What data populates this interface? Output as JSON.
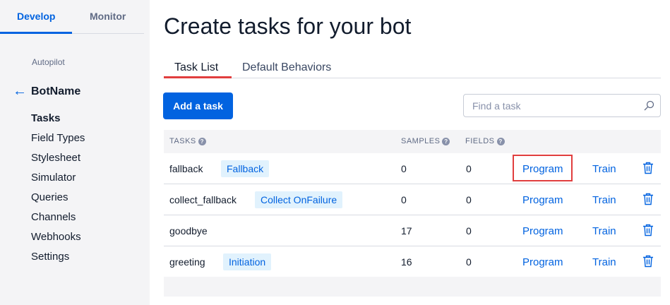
{
  "topnav": {
    "develop": "Develop",
    "monitor": "Monitor"
  },
  "sidebar": {
    "section": "Autopilot",
    "bot_name": "BotName",
    "items": [
      {
        "label": "Tasks"
      },
      {
        "label": "Field Types"
      },
      {
        "label": "Stylesheet"
      },
      {
        "label": "Simulator"
      },
      {
        "label": "Queries"
      },
      {
        "label": "Channels"
      },
      {
        "label": "Webhooks"
      },
      {
        "label": "Settings"
      }
    ]
  },
  "main": {
    "title": "Create tasks for your bot",
    "tabs": [
      {
        "label": "Task List"
      },
      {
        "label": "Default Behaviors"
      }
    ],
    "add_button": "Add a task",
    "search_placeholder": "Find a task"
  },
  "table": {
    "headers": {
      "tasks": "TASKS",
      "samples": "SAMPLES",
      "fields": "FIELDS"
    },
    "rows": [
      {
        "name": "fallback",
        "badge": "Fallback",
        "samples": "0",
        "fields": "0",
        "program": "Program",
        "train": "Train"
      },
      {
        "name": "collect_fallback",
        "badge": "Collect OnFailure",
        "samples": "0",
        "fields": "0",
        "program": "Program",
        "train": "Train"
      },
      {
        "name": "goodbye",
        "badge": "",
        "samples": "17",
        "fields": "0",
        "program": "Program",
        "train": "Train"
      },
      {
        "name": "greeting",
        "badge": "Initiation",
        "samples": "16",
        "fields": "0",
        "program": "Program",
        "train": "Train"
      }
    ]
  },
  "colors": {
    "accent": "#0263e0",
    "highlight": "#e13e3e",
    "badge_bg": "#e1f2fd"
  },
  "icons": {
    "back": "arrow-left-icon",
    "search": "search-icon",
    "delete": "trash-icon",
    "help": "question-icon"
  }
}
